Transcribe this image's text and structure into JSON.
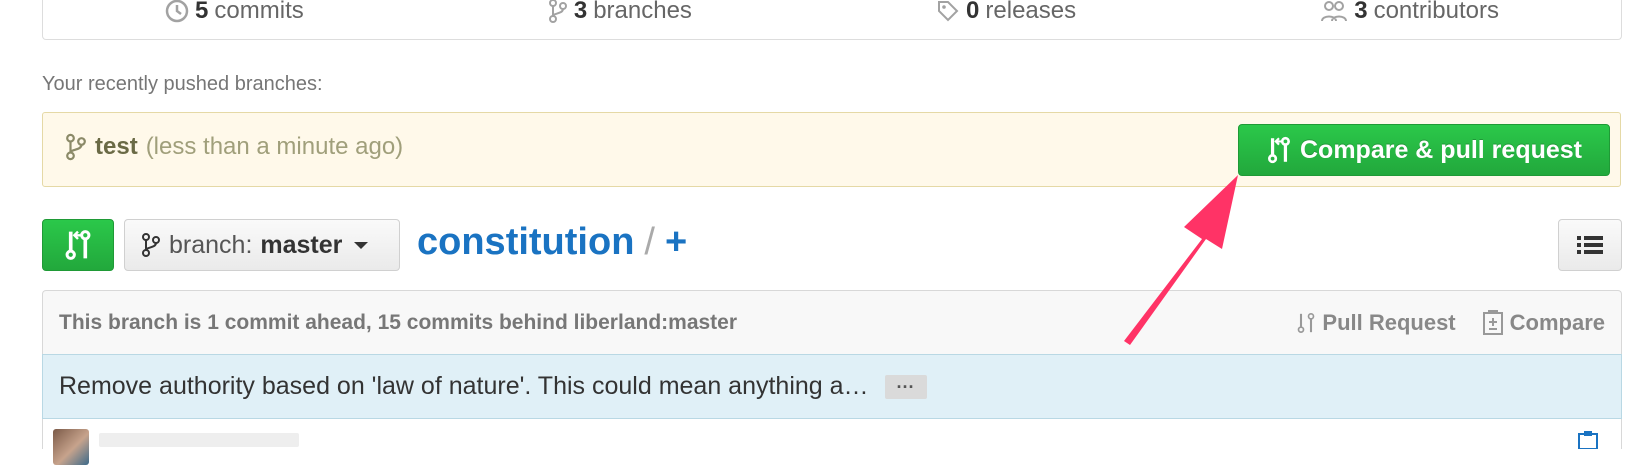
{
  "summary": {
    "commits": {
      "count": "5",
      "label": "commits"
    },
    "branches": {
      "count": "3",
      "label": "branches"
    },
    "releases": {
      "count": "0",
      "label": "releases"
    },
    "contributors": {
      "count": "3",
      "label": "contributors"
    }
  },
  "recent": {
    "label": "Your recently pushed branches:",
    "branch_name": "test",
    "time": "(less than a minute ago)",
    "compare_button": "Compare & pull request"
  },
  "toolbar": {
    "branch_prefix": "branch:",
    "branch_name": "master",
    "repo_name": "constitution",
    "path_separator": "/",
    "add_file": "+"
  },
  "branch_status": {
    "text": "This branch is 1 commit ahead, 15 commits behind liberland:master",
    "pull_request": "Pull Request",
    "compare": "Compare"
  },
  "latest_commit": {
    "message": "Remove authority based on 'law of nature'. This could mean anything a…",
    "expand": "···"
  },
  "colors": {
    "green": "#2bc84a",
    "link_blue": "#1a73c2",
    "arrow_pink": "#ff3366",
    "recent_bg": "#fff9ea",
    "commit_bg": "#e0f0f7"
  },
  "icons": [
    "commits-icon",
    "branch-icon",
    "tag-icon",
    "contributors-icon",
    "pull-request-icon",
    "compare-icon",
    "list-icon",
    "clipboard-icon"
  ]
}
